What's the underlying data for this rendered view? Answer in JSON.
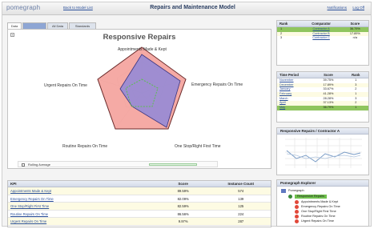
{
  "header": {
    "brand": "pomegraph",
    "back_link": "Back to Model List",
    "title": "Repairs and Maintenance Model",
    "links": [
      "Notifications",
      "Log Off"
    ]
  },
  "tabs": [
    {
      "label": "Data",
      "active": true
    },
    {
      "label": "",
      "active": false
    },
    {
      "label": "All Data",
      "active": false
    },
    {
      "label": "Standards",
      "active": false
    }
  ],
  "main": {
    "title": "Responsive Repairs",
    "expand_icon": "plus-icon",
    "legend_label": "Rolling Average",
    "radar_labels": [
      "Appointments Made & Kept",
      "Emergency Repairs On Time",
      "One Stop/Right First Time",
      "Routine Repairs On Time",
      "Urgent Repairs On Time"
    ],
    "colors": {
      "outer": "#f4a19b",
      "inner": "#8f88d8",
      "dashed": "#5cbf50"
    }
  },
  "kpi_table": {
    "headers": [
      "KPI",
      "Score",
      "Instance Count"
    ],
    "rows": [
      [
        "Appointments Made & Kept",
        "89.59%",
        "574"
      ],
      [
        "Emergency Repairs On Time",
        "82.09%",
        "139"
      ],
      [
        "One Stop/Right First Time",
        "82.59%",
        "125"
      ],
      [
        "Routine Repairs On Time",
        "86.56%",
        "224"
      ],
      [
        "Urgent Repairs On Time",
        "9.97%",
        "287"
      ]
    ]
  },
  "rank_table": {
    "headers": [
      "Rank",
      "Comparator",
      "Score"
    ],
    "rows": [
      [
        "1",
        "Contractor A",
        "36.79%"
      ],
      [
        "2",
        "Contractor B",
        "17.89%"
      ],
      [
        "3",
        "Contractor C",
        "n/a"
      ]
    ]
  },
  "period_table": {
    "headers": [
      "Time Period",
      "Score",
      "Rank"
    ],
    "rows": [
      [
        "November",
        "39.75%",
        "1"
      ],
      [
        "December",
        "17.89%",
        "3"
      ],
      [
        "January",
        "33.67%",
        "2"
      ],
      [
        "February",
        "41.28%",
        "1"
      ],
      [
        "March",
        "28.28%",
        "3"
      ],
      [
        "April",
        "37.13%",
        "2"
      ],
      [
        "May",
        "36.79%",
        "1"
      ]
    ]
  },
  "trend_panel": {
    "title": "Responsive Repairs / Contractor A"
  },
  "explorer": {
    "title": "Pomegraph Explorer",
    "items": [
      "Pomegraph",
      "Responsive Repairs",
      "Appointments Made & Kept",
      "Emergency Repairs On Time",
      "One Stop/Right First Time",
      "Routine Repairs On Time",
      "Urgent Repairs On Time"
    ]
  }
}
